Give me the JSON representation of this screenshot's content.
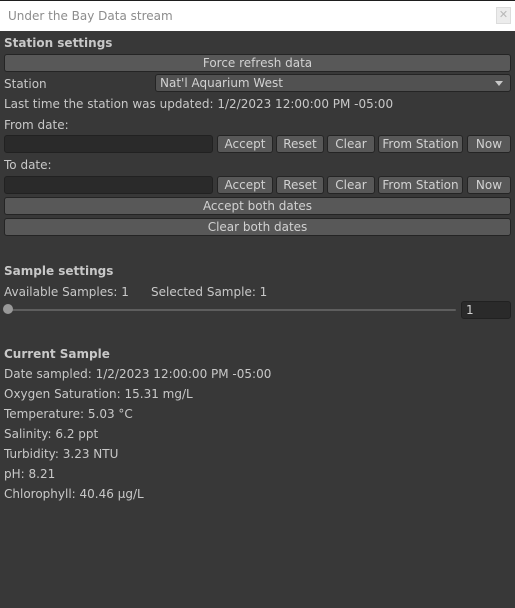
{
  "window": {
    "title": "Under the Bay Data stream",
    "close_glyph": "✕"
  },
  "station_settings": {
    "header": "Station settings",
    "force_refresh_label": "Force refresh data",
    "station_label": "Station",
    "station_selected": "Nat'l Aquarium West",
    "last_updated_text": "Last time the station was updated: 1/2/2023 12:00:00 PM -05:00",
    "from_date": {
      "label": "From date:",
      "value": "",
      "accept": "Accept",
      "reset": "Reset",
      "clear": "Clear",
      "from_station": "From Station",
      "now": "Now"
    },
    "to_date": {
      "label": "To date:",
      "value": "",
      "accept": "Accept",
      "reset": "Reset",
      "clear": "Clear",
      "from_station": "From Station",
      "now": "Now"
    },
    "accept_both_label": "Accept both dates",
    "clear_both_label": "Clear both dates"
  },
  "sample_settings": {
    "header": "Sample settings",
    "available_text": "Available Samples: 1",
    "selected_text": "Selected Sample: 1",
    "slider": {
      "min": 1,
      "max": 1,
      "value": 1
    },
    "slider_value_text": "1"
  },
  "current_sample": {
    "header": "Current Sample",
    "date_sampled": "Date sampled: 1/2/2023 12:00:00 PM -05:00",
    "oxygen": "Oxygen Saturation: 15.31 mg/L",
    "temperature": "Temperature: 5.03 °C",
    "salinity": "Salinity: 6.2 ppt",
    "turbidity": "Turbidity: 3.23 NTU",
    "ph": "pH: 8.21",
    "chlorophyll": "Chlorophyll: 40.46 μg/L"
  }
}
